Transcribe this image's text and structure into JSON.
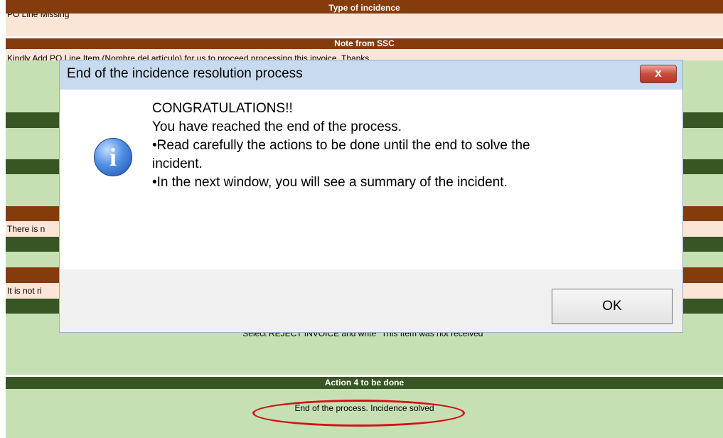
{
  "sheet": {
    "type_header": "Type of incidence",
    "type_value": "PO Line Missing",
    "note_header": "Note from SSC",
    "note_value": "Kindly Add PO Line Item (Nombre del artículo) for us to proceed processing this invoice. Thanks",
    "row_partial_1": "There is n",
    "row_partial_2": "It is not ri",
    "row_partial_3": "Select REJECT INVOICE and write \"This Item was not received\"",
    "action4_header": "Action 4 to be done",
    "action4_value": "End of the process. Incidence solved"
  },
  "dialog": {
    "title": "End of the incidence resolution process",
    "close_label": "x",
    "icon": "info-icon",
    "lines": [
      "CONGRATULATIONS!!",
      "You have reached the end of the process.",
      "•Read carefully the actions to be done until the end to solve the",
      "incident.",
      "•In the next window, you will see a summary of the incident."
    ],
    "ok_label": "OK"
  },
  "colors": {
    "brown_header": "#843c0c",
    "dark_green_header": "#375623",
    "light_green": "#c6e0b4",
    "light_pink": "#fbe5d6",
    "highlight": "#d80e16"
  }
}
